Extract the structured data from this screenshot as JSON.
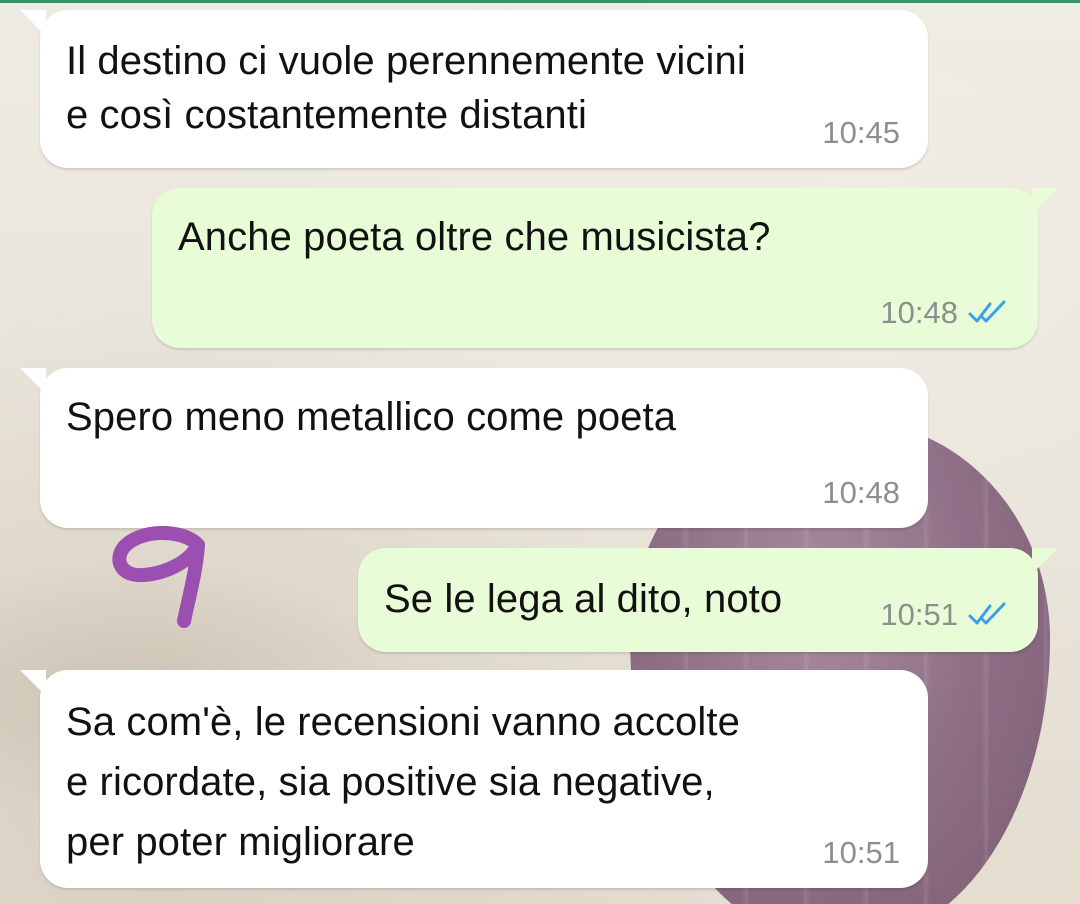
{
  "chat": {
    "messages": [
      {
        "direction": "incoming",
        "text": "Il destino ci vuole perennemente vicini\ne così costantemente distanti",
        "time": "10:45"
      },
      {
        "direction": "outgoing",
        "text": "Anche poeta oltre che musicista?",
        "time": "10:48",
        "status_icon": "double-check-read-icon"
      },
      {
        "direction": "incoming",
        "text": "Spero meno metallico come poeta",
        "time": "10:48"
      },
      {
        "direction": "outgoing",
        "text": "Se le lega al dito, noto",
        "time": "10:51",
        "status_icon": "double-check-read-icon"
      },
      {
        "direction": "incoming",
        "text": "Sa com'è, le recensioni vanno accolte\ne ricordate, sia positive sia negative,\nper poter migliorare",
        "time": "10:51"
      }
    ]
  },
  "annotation": {
    "icon": "handwritten-nine-mark",
    "color": "#9b4fb0"
  },
  "colors": {
    "incoming_bubble": "#ffffff",
    "outgoing_bubble": "#e9fcd8",
    "timestamp": "#8e8e8e",
    "read_ticks": "#3aa0e8"
  }
}
